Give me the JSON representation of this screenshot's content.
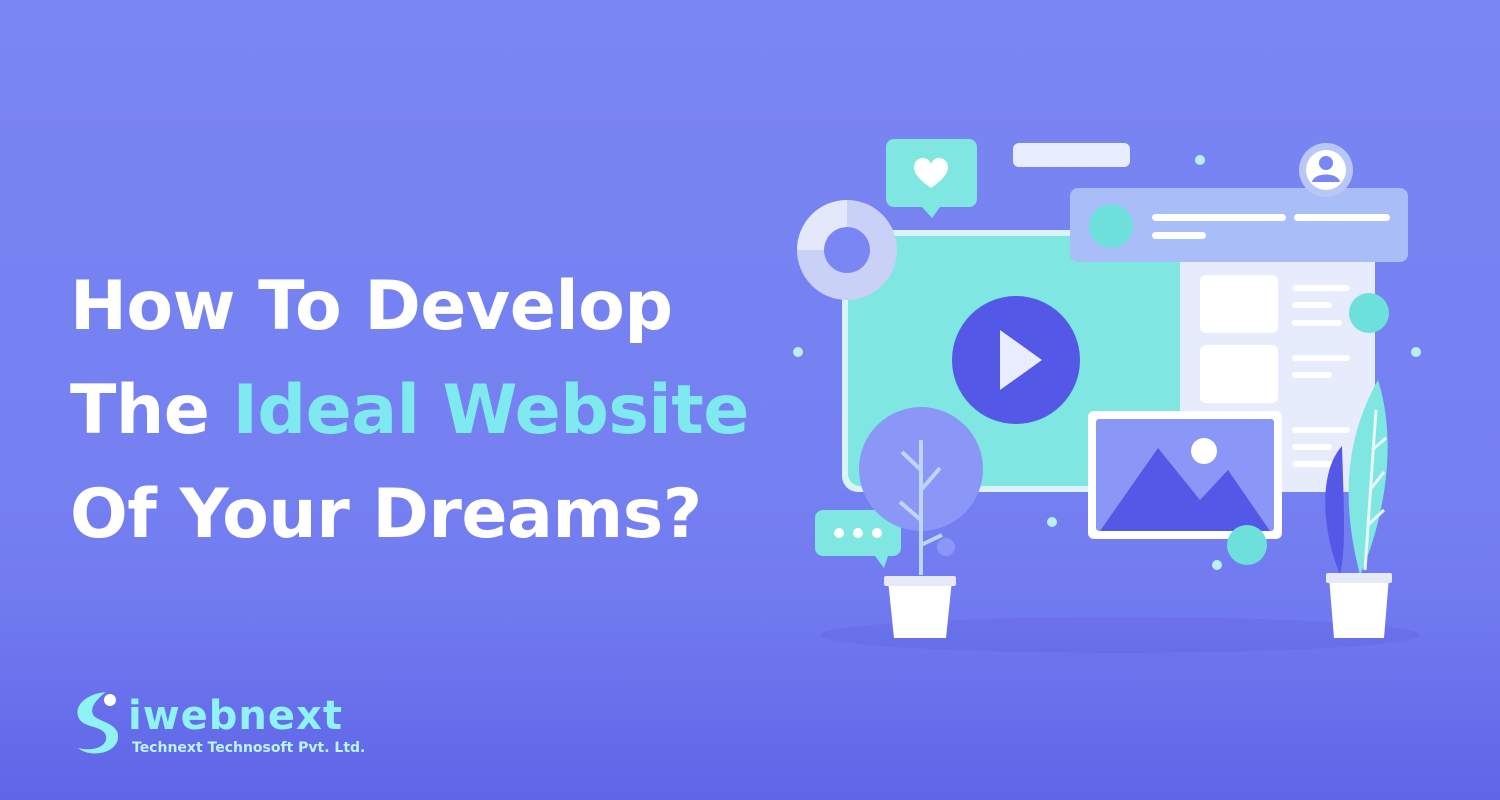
{
  "headline": {
    "line1": "How To Develop",
    "line2_prefix": "The ",
    "line2_accent": "Ideal Website",
    "line3": "Of Your Dreams?"
  },
  "brand": {
    "name": "iwebnext",
    "tagline": "Technext Technosoft Pvt. Ltd."
  },
  "colors": {
    "background": "#7a86f3",
    "accent": "#7eeaf0",
    "screen": "#7fe6e2",
    "play_button": "#5358e6"
  },
  "icons": [
    "heart-icon",
    "play-icon",
    "user-icon",
    "chat-dots-icon",
    "image-icon",
    "plant-icon"
  ]
}
